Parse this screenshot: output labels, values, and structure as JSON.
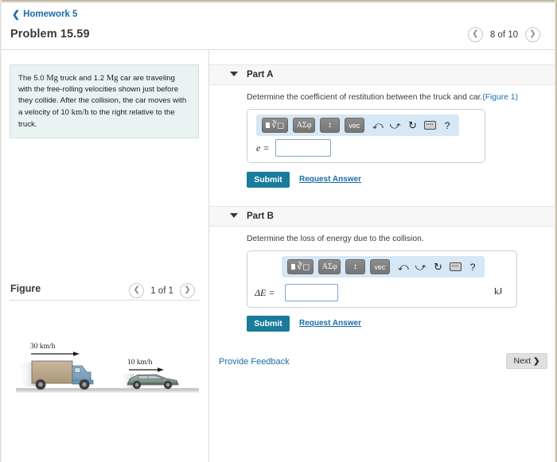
{
  "breadcrumb": {
    "label": "Homework 5",
    "icon": "chevron-left-icon"
  },
  "header": {
    "problem_title": "Problem 15.59",
    "pager": {
      "prev_icon": "chevron-left-icon",
      "text": "8 of 10",
      "next_icon": "chevron-right-icon"
    }
  },
  "statement": {
    "p1": "The 5.0 ",
    "mg1": "Mg",
    "p2": " truck and 1.2 ",
    "mg2": "Mg",
    "p3": " car are traveling with the free-rolling velocities shown just before they collide. After the collision, the car moves with a velocity of 10 ",
    "kmh": "km/h",
    "p4": " to the right relative to the truck."
  },
  "figure": {
    "label": "Figure",
    "pager": {
      "prev_icon": "chevron-left-icon",
      "text": "1 of 1",
      "next_icon": "chevron-right-icon"
    },
    "truck_speed": "30 km/h",
    "car_speed": "10 km/h",
    "truck_body_color": "#bda98e",
    "truck_cab_color": "#7ba3c0",
    "car_color": "#8a9e95",
    "ground_color": "#cfcfcf"
  },
  "toolbar": {
    "template_icon": "math-template-icon",
    "greek_label": "ΑΣφ",
    "updown_label": "↕",
    "vec_label": "vec",
    "undo_icon": "undo-arrow-icon",
    "redo_icon": "redo-arrow-icon",
    "reset_icon": "reset-circle-icon",
    "keyboard_icon": "keyboard-icon",
    "help_label": "?"
  },
  "parts": [
    {
      "id": "a",
      "label": "Part A",
      "caret_icon": "caret-down-icon",
      "prompt": "Determine the coefficient of restitution between the truck and car.",
      "prompt_link": "(Figure 1)",
      "answer_label": "e =",
      "answer_value": "",
      "unit": "",
      "submit_label": "Submit",
      "request_label": "Request Answer"
    },
    {
      "id": "b",
      "label": "Part B",
      "caret_icon": "caret-down-icon",
      "prompt": "Determine the loss of energy due to the collision.",
      "prompt_link": "",
      "answer_label": "ΔE =",
      "answer_value": "",
      "unit": "kJ",
      "submit_label": "Submit",
      "request_label": "Request Answer"
    }
  ],
  "footer": {
    "feedback_label": "Provide Feedback",
    "next_label": "Next",
    "next_icon": "chevron-right-icon"
  },
  "colors": {
    "link": "#1a6ea8",
    "submit_bg": "#1a7b9b",
    "statement_bg": "#e8f3f2",
    "mathbar_bg": "#d6e7f5",
    "band_bg": "#f7f7f7"
  }
}
